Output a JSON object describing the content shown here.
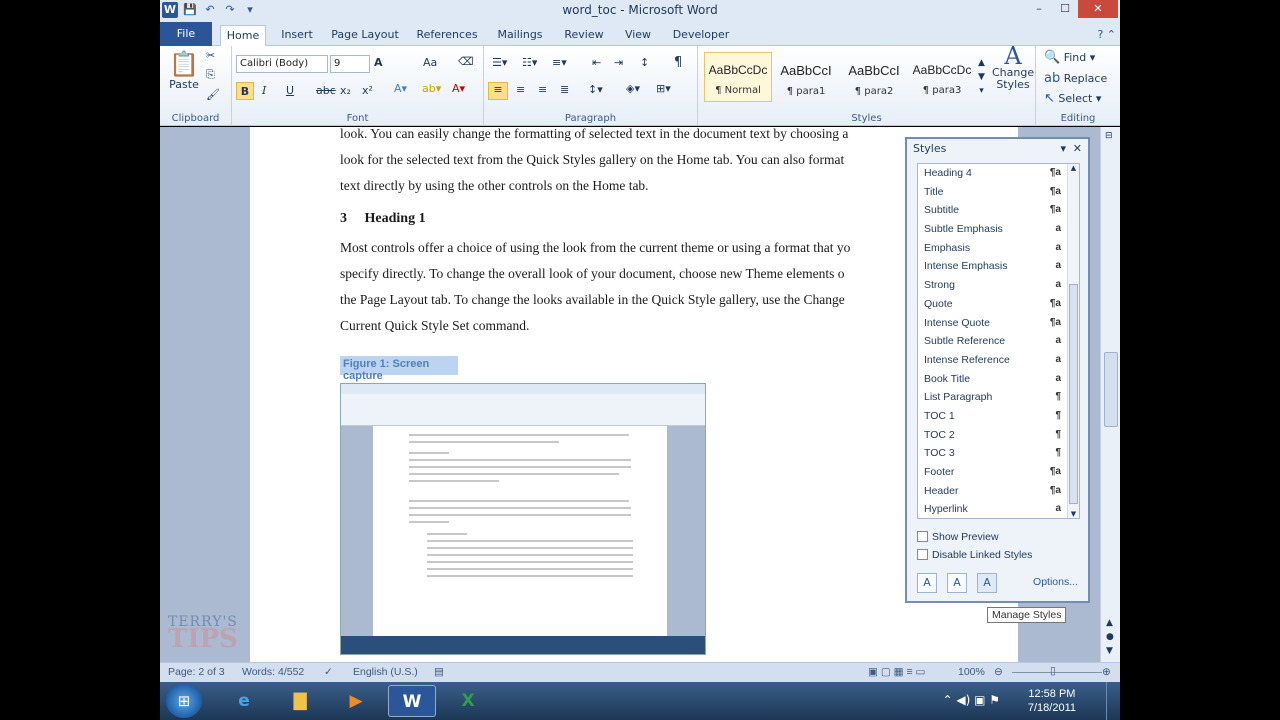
{
  "window": {
    "title": "word_toc - Microsoft Word",
    "controls": [
      "–",
      "☐",
      "✕"
    ]
  },
  "tabs": [
    "File",
    "Home",
    "Insert",
    "Page Layout",
    "References",
    "Mailings",
    "Review",
    "View",
    "Developer"
  ],
  "ribbon": {
    "clipboard": {
      "label": "Clipboard",
      "paste": "Paste"
    },
    "font": {
      "label": "Font",
      "family": "Calibri (Body)",
      "size": "9",
      "bold": "B",
      "italic": "I",
      "underline": "U",
      "strike": "abc",
      "sub": "x₂",
      "sup": "x²",
      "grow": "A",
      "case": "Aa"
    },
    "paragraph": {
      "label": "Paragraph",
      "pilcrow": "¶"
    },
    "styles": {
      "label": "Styles",
      "items": [
        {
          "sample": "AaBbCcDc",
          "name": "¶ Normal"
        },
        {
          "sample": "AaBbCcI",
          "name": "¶ para1"
        },
        {
          "sample": "AaBbCcI",
          "name": "¶ para2"
        },
        {
          "sample": "AaBbCcDc",
          "name": "¶ para3"
        }
      ],
      "change_styles": "Change Styles"
    },
    "editing": {
      "label": "Editing",
      "find": "Find",
      "replace": "Replace",
      "select": "Select"
    }
  },
  "document": {
    "para_top1": "look. You can easily change the formatting of selected text in the document text by choosing a",
    "para_top2": "look for the selected text from the Quick Styles gallery on the Home tab. You can also format",
    "para_top3": "text directly by using the other controls on the Home tab.",
    "heading_number": "3",
    "heading_text": "Heading 1",
    "para1": "Most controls offer a choice of using the look from the current theme or using a format that yo",
    "para2": "specify directly. To change the overall look of your document, choose new Theme elements o",
    "para3": "the Page Layout tab. To change the looks available in the Quick Style gallery, use the Change",
    "para4": "Current Quick Style Set command.",
    "caption": "Figure 1: Screen capture"
  },
  "styles_pane": {
    "title": "Styles",
    "items": [
      {
        "name": "Heading 4",
        "kind": "¶a"
      },
      {
        "name": "Title",
        "kind": "¶a"
      },
      {
        "name": "Subtitle",
        "kind": "¶a"
      },
      {
        "name": "Subtle Emphasis",
        "kind": "a"
      },
      {
        "name": "Emphasis",
        "kind": "a"
      },
      {
        "name": "Intense Emphasis",
        "kind": "a"
      },
      {
        "name": "Strong",
        "kind": "a"
      },
      {
        "name": "Quote",
        "kind": "¶a"
      },
      {
        "name": "Intense Quote",
        "kind": "¶a"
      },
      {
        "name": "Subtle Reference",
        "kind": "a"
      },
      {
        "name": "Intense Reference",
        "kind": "a"
      },
      {
        "name": "Book Title",
        "kind": "a"
      },
      {
        "name": "List Paragraph",
        "kind": "¶"
      },
      {
        "name": "TOC 1",
        "kind": "¶"
      },
      {
        "name": "TOC 2",
        "kind": "¶"
      },
      {
        "name": "TOC 3",
        "kind": "¶"
      },
      {
        "name": "Footer",
        "kind": "¶a"
      },
      {
        "name": "Header",
        "kind": "¶a"
      },
      {
        "name": "Hyperlink",
        "kind": "a"
      }
    ],
    "show_preview": "Show Preview",
    "disable_linked": "Disable Linked Styles",
    "options": "Options...",
    "tooltip": "Manage Styles"
  },
  "status": {
    "page": "Page: 2 of 3",
    "words": "Words: 4/552",
    "language": "English (U.S.)",
    "zoom": "100%"
  },
  "watermark": {
    "line1": "TERRY'S",
    "line2": "TIPS"
  },
  "taskbar": {
    "time": "12:58 PM",
    "date": "7/18/2011"
  }
}
